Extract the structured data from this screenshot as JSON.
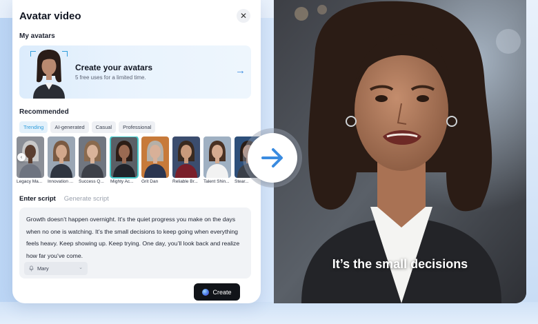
{
  "panel": {
    "title": "Avatar video",
    "close_glyph": "✕"
  },
  "my_avatars": {
    "section_label": "My avatars",
    "card_title": "Create your avatars",
    "card_subtitle": "5 free uses for a limited time.",
    "card_arrow": "→"
  },
  "recommended": {
    "section_label": "Recommended",
    "categories": [
      {
        "label": "Trending",
        "active": true
      },
      {
        "label": "AI-generated",
        "active": false
      },
      {
        "label": "Casual",
        "active": false
      },
      {
        "label": "Professional",
        "active": false
      }
    ],
    "avatars": [
      {
        "label": "Legacy Ma...",
        "bg": "#8b8f97",
        "skin": "#5a3e30",
        "hair": "#c9c9c9",
        "outfit": "#6e7480"
      },
      {
        "label": "Innovation ...",
        "bg": "#9aa6b4",
        "skin": "#d2a88c",
        "hair": "#7a5a42",
        "outfit": "#2f3540"
      },
      {
        "label": "Success Q...",
        "bg": "#707680",
        "skin": "#d9b39a",
        "hair": "#8a6a4e",
        "outfit": "#3d4048"
      },
      {
        "label": "Mighty Ac...",
        "bg": "#5a5f66",
        "skin": "#9a6a52",
        "hair": "#2c1d16",
        "outfit": "#20232a"
      },
      {
        "label": "Grit Dan",
        "bg": "#c77a3a",
        "skin": "#d8b098",
        "hair": "#b5b0a8",
        "outfit": "#2a3550"
      },
      {
        "label": "Reliable Br...",
        "bg": "#3b4d6e",
        "skin": "#c99a7c",
        "hair": "#3a2a20",
        "outfit": "#7a1f2a"
      },
      {
        "label": "Talent Shin...",
        "bg": "#9fb0c2",
        "skin": "#d6ab90",
        "hair": "#4a3224",
        "outfit": "#f2f2f2"
      },
      {
        "label": "Stear...",
        "bg": "#2d4f7a",
        "skin": "#c89a80",
        "hair": "#2a1e18",
        "outfit": "#3a3f48"
      }
    ],
    "scroll_left_glyph": "‹"
  },
  "script": {
    "tabs": [
      {
        "label": "Enter script",
        "active": true
      },
      {
        "label": "Generate script",
        "active": false
      }
    ],
    "text": "Growth doesn’t happen overnight. It’s the quiet progress you make on the days when no one is watching. It’s the small decisions to keep going when everything feels heavy. Keep showing up. Keep trying. One day, you’ll look back and realize how far you’ve come.",
    "voice": "Mary",
    "voice_icon": "microphone-icon",
    "voice_chevron": "⌄"
  },
  "create_button": {
    "label": "Create"
  },
  "video": {
    "subtitle": "It’s the small decisions"
  },
  "colors": {
    "accent": "#2d9cdb",
    "selected_outline": "#43c9c9",
    "arrow_blue": "#3a8be0"
  }
}
